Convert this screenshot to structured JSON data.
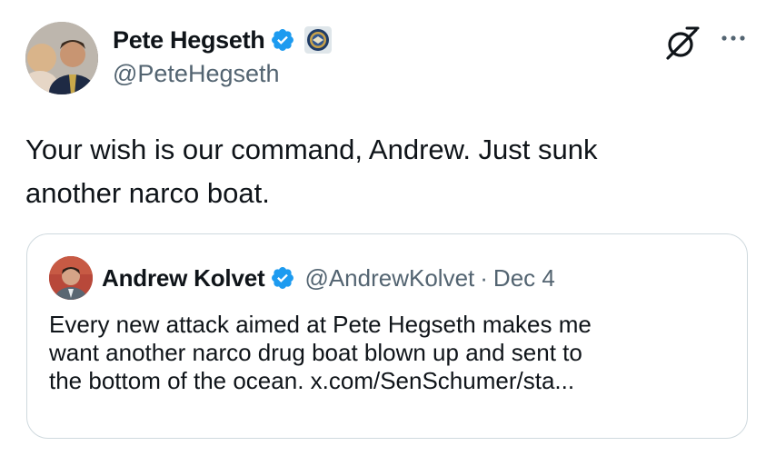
{
  "author": {
    "display_name": "Pete Hegseth",
    "handle": "@PeteHegseth",
    "verified": true,
    "affiliation_badge": "department-seal-icon"
  },
  "tweet": {
    "text_lines": [
      "Your wish is our command, Andrew. Just sunk",
      "another narco boat."
    ]
  },
  "actions": {
    "grok_icon": "grok-icon",
    "more_icon": "more-options-icon"
  },
  "quoted_tweet": {
    "display_name": "Andrew Kolvet",
    "handle": "@AndrewKolvet",
    "separator": "·",
    "date": "Dec 4",
    "verified": true,
    "text_lines": [
      "Every new attack aimed at Pete Hegseth makes me",
      "want another narco drug boat blown up and sent to",
      "the bottom of the ocean. x.com/SenSchumer/sta..."
    ]
  },
  "colors": {
    "text_primary": "#0f1419",
    "text_secondary": "#536471",
    "verified_blue": "#1d9bf0",
    "quote_border": "#cfd9de"
  }
}
